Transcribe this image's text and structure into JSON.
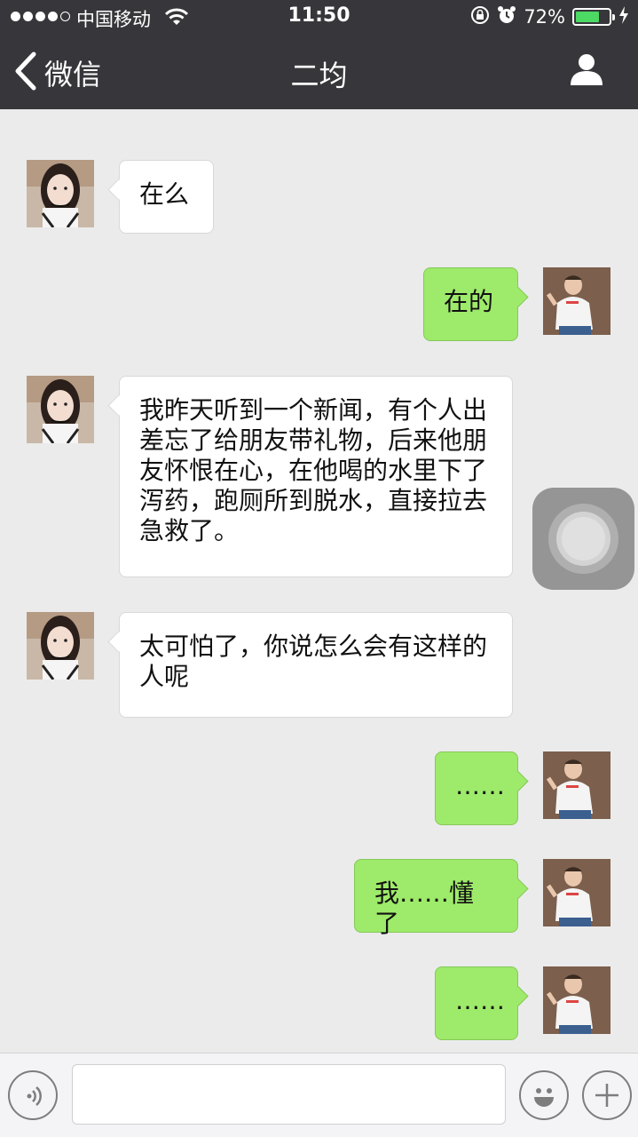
{
  "status_bar": {
    "carrier": "中国移动",
    "time": "11:50",
    "battery_percent": "72%",
    "battery_level": 0.72,
    "signal_bars_filled": 4,
    "signal_bars_total": 5
  },
  "nav": {
    "back_label": "微信",
    "title": "二均"
  },
  "messages": [
    {
      "side": "in",
      "text": "在么"
    },
    {
      "side": "out",
      "text": "在的"
    },
    {
      "side": "in",
      "text": "我昨天听到一个新闻，有个人出差忘了给朋友带礼物，后来他朋友怀恨在心，在他喝的水里下了泻药，跑厕所到脱水，直接拉去急救了。"
    },
    {
      "side": "in",
      "text": "太可怕了，你说怎么会有这样的人呢"
    },
    {
      "side": "out",
      "text": "……"
    },
    {
      "side": "out",
      "text": "我……懂了"
    },
    {
      "side": "out",
      "text": "……"
    }
  ],
  "colors": {
    "nav_bg": "#37373b",
    "chat_bg": "#ebebeb",
    "bubble_out": "#9eea6a",
    "bubble_in": "#ffffff",
    "battery": "#4cd964"
  },
  "icons": {
    "back": "chevron-left-icon",
    "profile": "person-icon",
    "voice": "voice-icon",
    "emoji": "emoji-icon",
    "more": "plus-icon"
  },
  "input": {
    "value": ""
  }
}
